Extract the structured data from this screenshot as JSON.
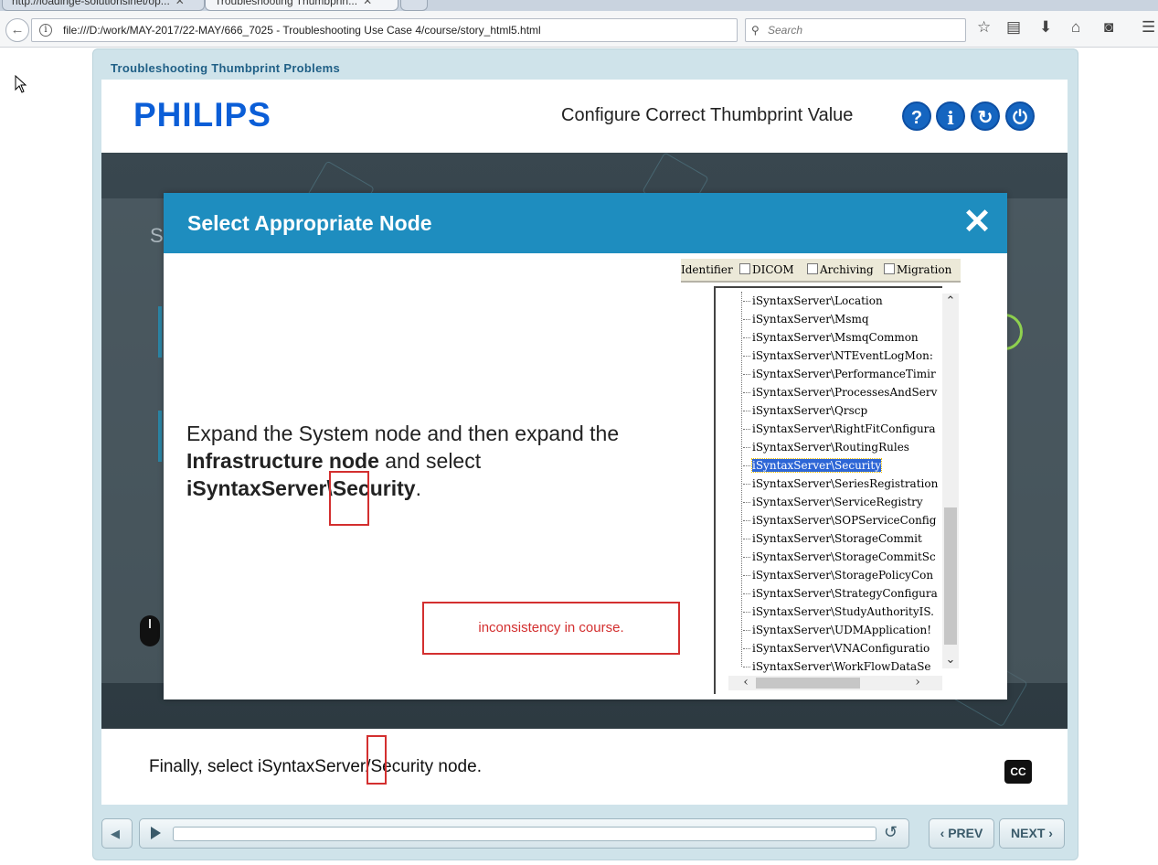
{
  "browser": {
    "tabs": [
      {
        "label": "http://loadinge-solutionsinet/op..."
      },
      {
        "label": "Troubleshooting Thumbprin..."
      }
    ],
    "url": "file:///D:/work/MAY-2017/22-MAY/666_7025 - Troubleshooting Use Case 4/course/story_html5.html",
    "search_placeholder": "Search"
  },
  "player": {
    "course_title": "Troubleshooting Thumbprint Problems",
    "logo": "PHILIPS",
    "slide_title": "Configure Correct Thumbprint Value",
    "header_buttons": [
      "?",
      "i",
      "↻",
      "⏻"
    ],
    "caption": "Finally, select iSyntaxServer/Security node.",
    "cc_label": "CC",
    "prev_label": "‹ PREV",
    "next_label": "NEXT ›"
  },
  "modal": {
    "title": "Select Appropriate Node",
    "close_label": "✕",
    "instruction": {
      "part1": "Expand the System node and then expand the ",
      "bold1": "Infrastructure node",
      "part2": " and select ",
      "bold2": "iSyntaxServer\\Security",
      "part3": "."
    },
    "note": "inconsistency in course.",
    "shot_tabs": [
      "Identifier",
      "DICOM",
      "Archiving",
      "Migration"
    ],
    "tree_nodes": [
      "iSyntaxServer\\Location",
      "iSyntaxServer\\Msmq",
      "iSyntaxServer\\MsmqCommon",
      "iSyntaxServer\\NTEventLogMon:",
      "iSyntaxServer\\PerformanceTimir",
      "iSyntaxServer\\ProcessesAndServ",
      "iSyntaxServer\\Qrscp",
      "iSyntaxServer\\RightFitConfigura",
      "iSyntaxServer\\RoutingRules",
      "iSyntaxServer\\Security",
      "iSyntaxServer\\SeriesRegistration",
      "iSyntaxServer\\ServiceRegistry",
      "iSyntaxServer\\SOPServiceConfig",
      "iSyntaxServer\\StorageCommit",
      "iSyntaxServer\\StorageCommitSc",
      "iSyntaxServer\\StoragePolicyCon",
      "iSyntaxServer\\StrategyConfigura",
      "iSyntaxServer\\StudyAuthorityIS.",
      "iSyntaxServer\\UDMApplication!",
      "iSyntaxServer\\VNAConfiguratio",
      "iSyntaxServer\\WorkFlowDataSe"
    ],
    "selected_node": "iSyntaxServer\\Security"
  },
  "colors": {
    "accent": "#1e8dbf",
    "brand": "#0b5ed7",
    "annotation": "#d32f2f",
    "header_button": "#1565c0"
  }
}
